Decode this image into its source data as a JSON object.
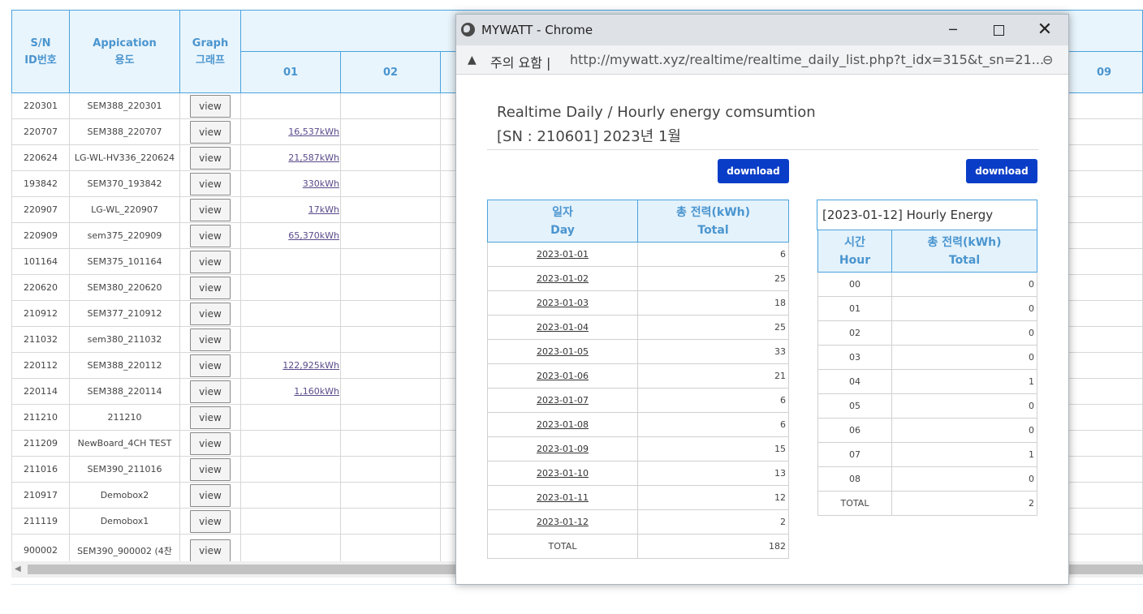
{
  "background": {
    "headers": {
      "sn_line1": "S/N",
      "sn_line2": "ID번호",
      "app_line1": "Appication",
      "app_line2": "용도",
      "graph_line1": "Graph",
      "graph_line2": "그래프",
      "col_01": "01",
      "col_02": "02",
      "col_09": "09"
    },
    "view_label": "view",
    "rows": [
      {
        "id": "220301",
        "app": "SEM388_220301",
        "d01": ""
      },
      {
        "id": "220707",
        "app": "SEM388_220707",
        "d01": "16,537kWh"
      },
      {
        "id": "220624",
        "app": "LG-WL-HV336_220624",
        "d01": "21,587kWh"
      },
      {
        "id": "193842",
        "app": "SEM370_193842",
        "d01": "330kWh"
      },
      {
        "id": "220907",
        "app": "LG-WL_220907",
        "d01": "17kWh"
      },
      {
        "id": "220909",
        "app": "sem375_220909",
        "d01": "65,370kWh"
      },
      {
        "id": "101164",
        "app": "SEM375_101164",
        "d01": ""
      },
      {
        "id": "220620",
        "app": "SEM380_220620",
        "d01": ""
      },
      {
        "id": "210912",
        "app": "SEM377_210912",
        "d01": ""
      },
      {
        "id": "211032",
        "app": "sem380_211032",
        "d01": ""
      },
      {
        "id": "220112",
        "app": "SEM388_220112",
        "d01": "122,925kWh"
      },
      {
        "id": "220114",
        "app": "SEM388_220114",
        "d01": "1,160kWh"
      },
      {
        "id": "211210",
        "app": "211210",
        "d01": ""
      },
      {
        "id": "211209",
        "app": "NewBoard_4CH TEST",
        "d01": ""
      },
      {
        "id": "211016",
        "app": "SEM390_211016",
        "d01": ""
      },
      {
        "id": "210917",
        "app": "Demobox2",
        "d01": ""
      },
      {
        "id": "211119",
        "app": "Demobox1",
        "d01": ""
      },
      {
        "id": "900002",
        "app": "SEM390_900002 (4찬",
        "d01": ""
      }
    ]
  },
  "popup": {
    "window_title": "MYWATT - Chrome",
    "window_controls": {
      "minimize": "─",
      "close": "✕"
    },
    "warning_icon": "▲",
    "warning_text": "주의 요함 |",
    "url": "http://mywatt.xyz/realtime/realtime_daily_list.php?t_idx=315&t_sn=21...",
    "zoom_icon": "⊖",
    "heading_line1": "Realtime Daily / Hourly energy comsumtion",
    "heading_line2": "[SN : 210601] 2023년 1월",
    "download_label": "download",
    "daily": {
      "col1_line1": "일자",
      "col1_line2": "Day",
      "col2_line1": "총 전력(kWh)",
      "col2_line2": "Total",
      "rows": [
        {
          "date": "2023-01-01",
          "total": "6"
        },
        {
          "date": "2023-01-02",
          "total": "25"
        },
        {
          "date": "2023-01-03",
          "total": "18"
        },
        {
          "date": "2023-01-04",
          "total": "25"
        },
        {
          "date": "2023-01-05",
          "total": "33"
        },
        {
          "date": "2023-01-06",
          "total": "21"
        },
        {
          "date": "2023-01-07",
          "total": "6"
        },
        {
          "date": "2023-01-08",
          "total": "6"
        },
        {
          "date": "2023-01-09",
          "total": "15"
        },
        {
          "date": "2023-01-10",
          "total": "13"
        },
        {
          "date": "2023-01-11",
          "total": "12"
        },
        {
          "date": "2023-01-12",
          "total": "2"
        }
      ],
      "total_label": "TOTAL",
      "total_value": "182"
    },
    "hourly": {
      "caption": "[2023-01-12] Hourly Energy",
      "col1_line1": "시간",
      "col1_line2": "Hour",
      "col2_line1": "총 전력(kWh)",
      "col2_line2": "Total",
      "rows": [
        {
          "hour": "00",
          "total": "0"
        },
        {
          "hour": "01",
          "total": "0"
        },
        {
          "hour": "02",
          "total": "0"
        },
        {
          "hour": "03",
          "total": "0"
        },
        {
          "hour": "04",
          "total": "1"
        },
        {
          "hour": "05",
          "total": "0"
        },
        {
          "hour": "06",
          "total": "0"
        },
        {
          "hour": "07",
          "total": "1"
        },
        {
          "hour": "08",
          "total": "0"
        }
      ],
      "total_label": "TOTAL",
      "total_value": "2"
    }
  }
}
